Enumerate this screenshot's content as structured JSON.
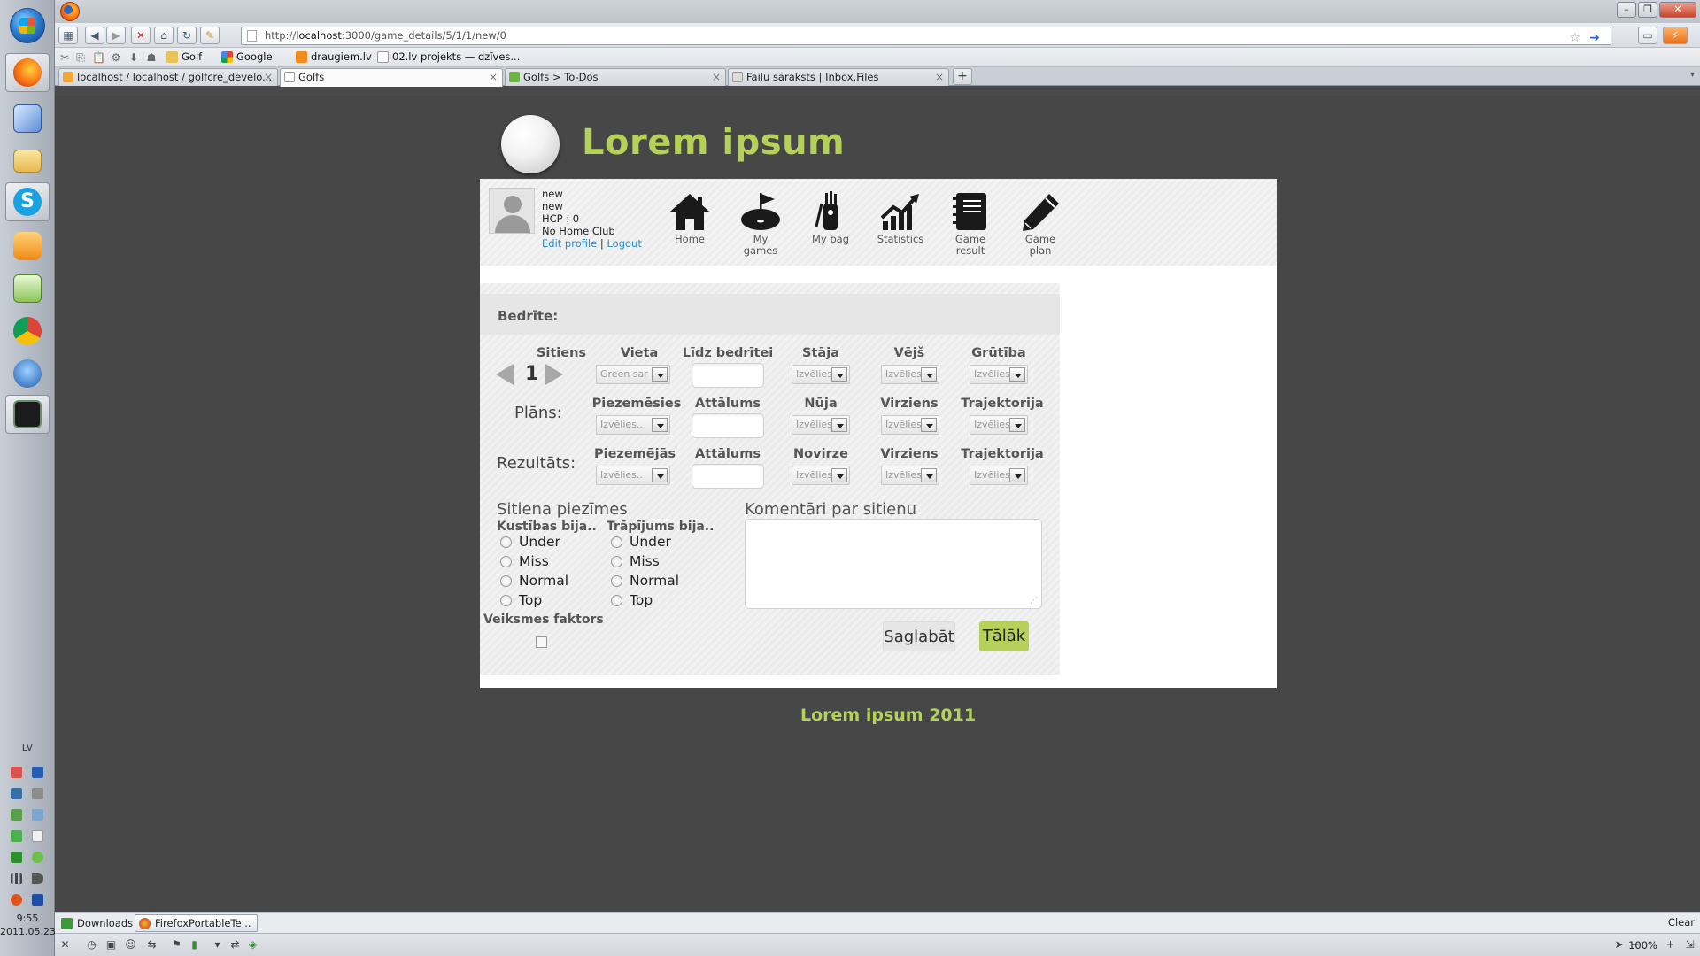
{
  "browser": {
    "url_prefix": "http://",
    "url_host": "localhost",
    "url_path": ":3000/game_details/5/1/1/new/0",
    "bookmarks": [
      "Golf",
      "Google",
      "draugiem.lv",
      "02.lv projekts — dzīves..."
    ],
    "tabs": [
      {
        "title": "localhost / localhost / golfcre_develo...",
        "active": false
      },
      {
        "title": "Golfs",
        "active": true
      },
      {
        "title": "Golfs > To-Dos",
        "active": false
      },
      {
        "title": "Failu saraksts | Inbox.Files",
        "active": false
      }
    ],
    "new_tab": "+",
    "downloads": [
      "Downloads",
      "FirefoxPortableTe..."
    ],
    "clear": "Clear",
    "zoom": "100%"
  },
  "os": {
    "lang": "LV",
    "time": "9:55",
    "date": "2011.05.23."
  },
  "site": {
    "title": "Lorem ipsum",
    "footer": "Lorem ipsum 2011",
    "accent_color": "#b6d15a"
  },
  "user": {
    "line1": "new",
    "line2": "new",
    "hcp": "HCP : 0",
    "club": "No Home Club",
    "edit_profile": "Edit profile",
    "sep": "|",
    "logout": "Logout"
  },
  "nav": [
    {
      "label": "Home",
      "icon": "home-icon"
    },
    {
      "label": "My\ngames",
      "icon": "golf-flag-icon"
    },
    {
      "label": "My bag",
      "icon": "golf-bag-icon"
    },
    {
      "label": "Statistics",
      "icon": "chart-icon"
    },
    {
      "label": "Game\nresult",
      "icon": "notebook-icon"
    },
    {
      "label": "Game\nplan",
      "icon": "pencil-icon"
    }
  ],
  "form": {
    "hole_label": "Bedrīte:",
    "row1": {
      "sitiens": "Sitiens",
      "stroke_number": "1",
      "vieta": "Vieta",
      "vieta_value": "Green sar",
      "lidz_bedritei": "Līdz bedrītei",
      "staja": "Stāja",
      "vejs": "Vējš",
      "grutiba": "Grūtība",
      "placeholder": "Izvēlies.."
    },
    "row2": {
      "label": "Plāns:",
      "piezemesies": "Piezemēsies",
      "attalums": "Attālums",
      "nuja": "Nūja",
      "virziens": "Virziens",
      "trajektorija": "Trajektorija",
      "placeholder": "Izvēlies.."
    },
    "row3": {
      "label": "Rezultāts:",
      "piezemejas": "Piezemējās",
      "attalums": "Attālums",
      "novirze": "Novirze",
      "virziens": "Virziens",
      "trajektorija": "Trajektorija",
      "placeholder": "Izvēlies.."
    },
    "notes_title": "Sitiena piezīmes",
    "comments_title": "Komentāri par sitienu",
    "movement_title": "Kustības bija..",
    "hit_title": "Trāpījums bija..",
    "options": [
      "Under",
      "Miss",
      "Normal",
      "Top"
    ],
    "luck_label": "Veiksmes faktors",
    "save_label": "Saglabāt",
    "next_label": "Tālāk"
  }
}
